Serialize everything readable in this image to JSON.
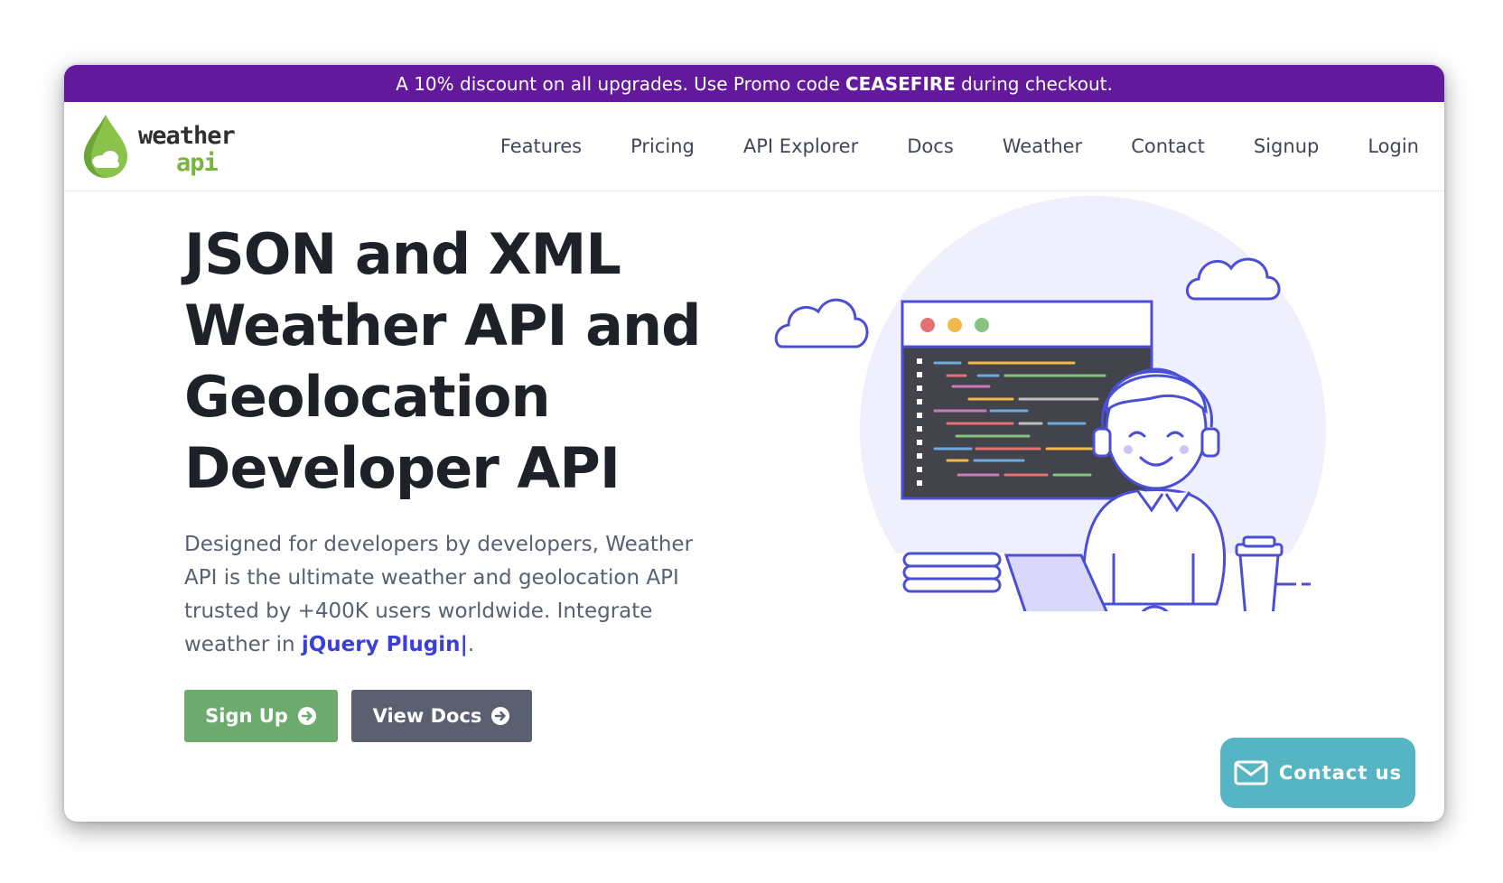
{
  "promo": {
    "text_before": "A 10% discount on all upgrades. Use Promo code",
    "code": "CEASEFIRE",
    "text_after": "during checkout."
  },
  "logo": {
    "word1": "weather",
    "word2": "api"
  },
  "nav": {
    "items": [
      "Features",
      "Pricing",
      "API Explorer",
      "Docs",
      "Weather",
      "Contact",
      "Signup",
      "Login"
    ]
  },
  "hero": {
    "title_lines": [
      "JSON and XML",
      "Weather API and",
      "Geolocation",
      "Developer API"
    ],
    "description": "Designed for developers by developers, Weather API is the ultimate weather and geolocation API trusted by +400K users worldwide. Integrate weather in ",
    "typed_text": "jQuery Plugin|",
    "description_end": ".",
    "signup_label": "Sign Up",
    "docs_label": "View Docs"
  },
  "contact": {
    "label": "Contact us"
  },
  "colors": {
    "promo_bg": "#63199c",
    "accent_blue": "#4a4fd6",
    "signup_green": "#6cab6d",
    "docs_gray": "#5b6071",
    "contact_teal": "#55b5c2",
    "logo_green": "#7bb342"
  },
  "icons": {
    "logo": "water-drop-cloud-icon",
    "button_arrow": "arrow-circle-right-icon",
    "contact": "envelope-icon"
  }
}
